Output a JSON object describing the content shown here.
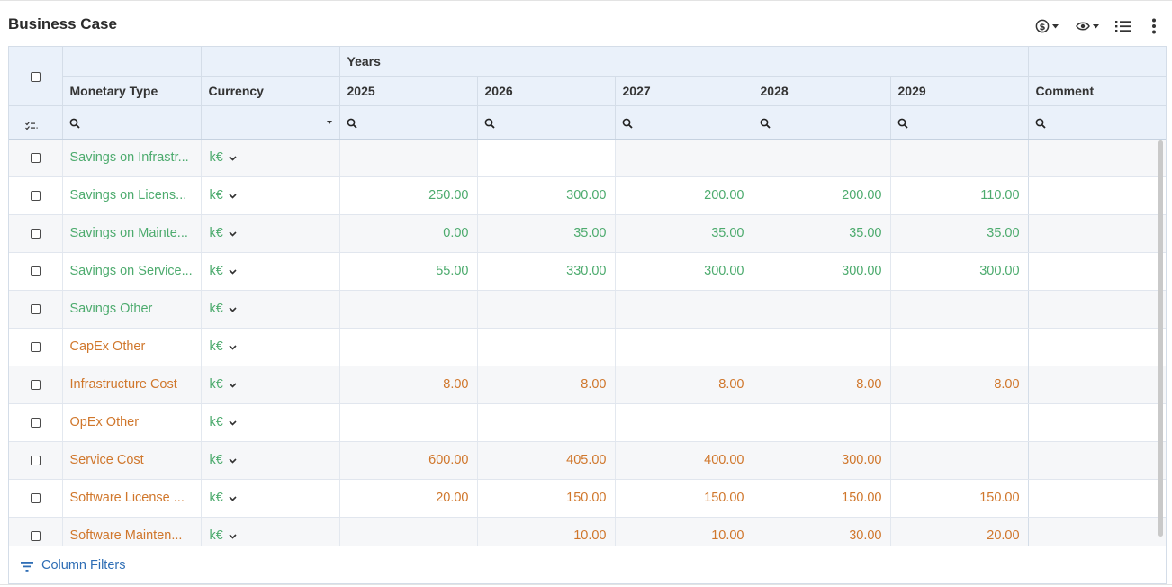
{
  "title": "Business Case",
  "toolbar": {
    "currency_icon": "dollar-circle-icon",
    "view_icon": "eye-icon",
    "list_icon": "list-icon",
    "more_icon": "more-vertical-icon"
  },
  "columns": {
    "years_group": "Years",
    "monetary_type": "Monetary Type",
    "currency": "Currency",
    "years": [
      "2025",
      "2026",
      "2027",
      "2028",
      "2029"
    ],
    "comment": "Comment"
  },
  "colors": {
    "savings": "#4dab6e",
    "cost": "#d0772c",
    "accent": "#2f6eb5",
    "header_bg": "#eaf1fa"
  },
  "rows": [
    {
      "type": "Savings on Infrastr...",
      "category": "savings",
      "currency": "k€",
      "values": [
        "",
        "",
        "",
        "",
        ""
      ],
      "comment": ""
    },
    {
      "type": "Savings on Licens...",
      "category": "savings",
      "currency": "k€",
      "values": [
        "250.00",
        "300.00",
        "200.00",
        "200.00",
        "110.00"
      ],
      "comment": ""
    },
    {
      "type": "Savings on Mainte...",
      "category": "savings",
      "currency": "k€",
      "values": [
        "0.00",
        "35.00",
        "35.00",
        "35.00",
        "35.00"
      ],
      "comment": ""
    },
    {
      "type": "Savings on Service...",
      "category": "savings",
      "currency": "k€",
      "values": [
        "55.00",
        "330.00",
        "300.00",
        "300.00",
        "300.00"
      ],
      "comment": ""
    },
    {
      "type": "Savings Other",
      "category": "savings",
      "currency": "k€",
      "values": [
        "",
        "",
        "",
        "",
        ""
      ],
      "comment": ""
    },
    {
      "type": "CapEx Other",
      "category": "cost",
      "currency": "k€",
      "values": [
        "",
        "",
        "",
        "",
        ""
      ],
      "comment": ""
    },
    {
      "type": "Infrastructure Cost",
      "category": "cost",
      "currency": "k€",
      "values": [
        "8.00",
        "8.00",
        "8.00",
        "8.00",
        "8.00"
      ],
      "comment": ""
    },
    {
      "type": "OpEx Other",
      "category": "cost",
      "currency": "k€",
      "values": [
        "",
        "",
        "",
        "",
        ""
      ],
      "comment": ""
    },
    {
      "type": "Service Cost",
      "category": "cost",
      "currency": "k€",
      "values": [
        "600.00",
        "405.00",
        "400.00",
        "300.00",
        ""
      ],
      "comment": ""
    },
    {
      "type": "Software License ...",
      "category": "cost",
      "currency": "k€",
      "values": [
        "20.00",
        "150.00",
        "150.00",
        "150.00",
        "150.00"
      ],
      "comment": ""
    },
    {
      "type": "Software Mainten...",
      "category": "cost",
      "currency": "k€",
      "values": [
        "",
        "10.00",
        "10.00",
        "30.00",
        "20.00"
      ],
      "comment": ""
    }
  ],
  "footer": {
    "column_filters": "Column Filters"
  }
}
